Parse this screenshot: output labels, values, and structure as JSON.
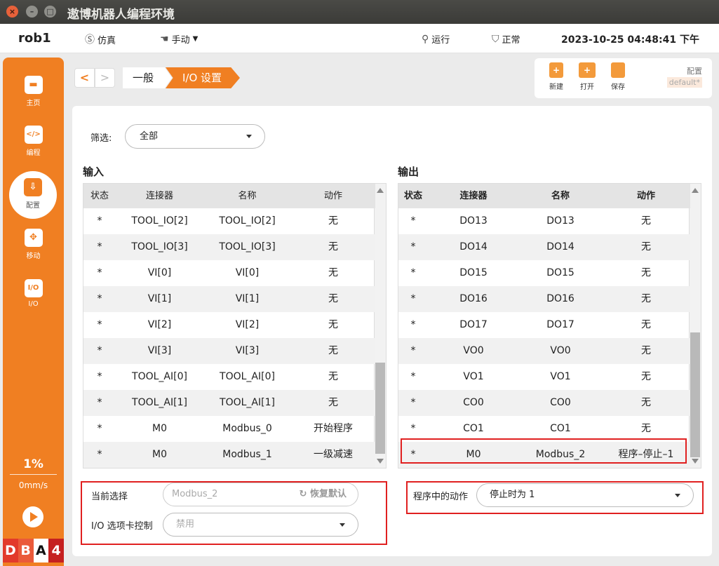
{
  "window": {
    "title": "遨博机器人编程环境",
    "close": "×",
    "minimize": "–",
    "maximize": "□"
  },
  "header": {
    "robot": "rob1",
    "mode_sim": "仿真",
    "mode_manual": "手动",
    "run_status": "运行",
    "safety_status": "正常",
    "datetime": "2023-10-25 04:48:41 下午"
  },
  "sidebar": {
    "items": [
      {
        "label": "主页",
        "icon": "home-icon",
        "glyph": "▬"
      },
      {
        "label": "编程",
        "icon": "code-icon",
        "glyph": "</>"
      },
      {
        "label": "配置",
        "icon": "config-icon",
        "glyph": "⇩"
      },
      {
        "label": "移动",
        "icon": "move-icon",
        "glyph": "✥"
      },
      {
        "label": "I/O",
        "icon": "io-icon",
        "glyph": "I/O"
      }
    ],
    "speed_percent": "1%",
    "speed_value": "0mm/s",
    "badges": [
      "D",
      "B",
      "A",
      "4"
    ]
  },
  "breadcrumb": {
    "back": "<",
    "forward": ">",
    "level1": "一般",
    "level2": "I/O 设置"
  },
  "toolbar": {
    "new": "新建",
    "open": "打开",
    "save": "保存",
    "config_label": "配置",
    "config_value": "default*"
  },
  "filter": {
    "label": "筛选:",
    "value": "全部"
  },
  "inputs": {
    "title": "输入",
    "columns": [
      "状态",
      "连接器",
      "名称",
      "动作"
    ],
    "rows": [
      [
        "*",
        "TOOL_IO[2]",
        "TOOL_IO[2]",
        "无"
      ],
      [
        "*",
        "TOOL_IO[3]",
        "TOOL_IO[3]",
        "无"
      ],
      [
        "*",
        "VI[0]",
        "VI[0]",
        "无"
      ],
      [
        "*",
        "VI[1]",
        "VI[1]",
        "无"
      ],
      [
        "*",
        "VI[2]",
        "VI[2]",
        "无"
      ],
      [
        "*",
        "VI[3]",
        "VI[3]",
        "无"
      ],
      [
        "*",
        "TOOL_AI[0]",
        "TOOL_AI[0]",
        "无"
      ],
      [
        "*",
        "TOOL_AI[1]",
        "TOOL_AI[1]",
        "无"
      ],
      [
        "*",
        "M0",
        "Modbus_0",
        "开始程序"
      ],
      [
        "*",
        "M0",
        "Modbus_1",
        "一级减速"
      ]
    ]
  },
  "outputs": {
    "title": "输出",
    "columns": [
      "状态",
      "连接器",
      "名称",
      "动作"
    ],
    "rows": [
      [
        "*",
        "DO13",
        "DO13",
        "无"
      ],
      [
        "*",
        "DO14",
        "DO14",
        "无"
      ],
      [
        "*",
        "DO15",
        "DO15",
        "无"
      ],
      [
        "*",
        "DO16",
        "DO16",
        "无"
      ],
      [
        "*",
        "DO17",
        "DO17",
        "无"
      ],
      [
        "*",
        "VO0",
        "VO0",
        "无"
      ],
      [
        "*",
        "VO1",
        "VO1",
        "无"
      ],
      [
        "*",
        "CO0",
        "CO0",
        "无"
      ],
      [
        "*",
        "CO1",
        "CO1",
        "无"
      ],
      [
        "*",
        "M0",
        "Modbus_2",
        "程序–停止–1"
      ]
    ]
  },
  "selection": {
    "current_label": "当前选择",
    "current_value": "Modbus_2",
    "restore_label": "恢复默认",
    "io_tab_label": "I/O 选项卡控制",
    "io_tab_value": "禁用",
    "action_label": "程序中的动作",
    "action_value": "停止时为 1"
  },
  "colors": {
    "accent": "#f07f22",
    "highlight": "#e02020"
  }
}
